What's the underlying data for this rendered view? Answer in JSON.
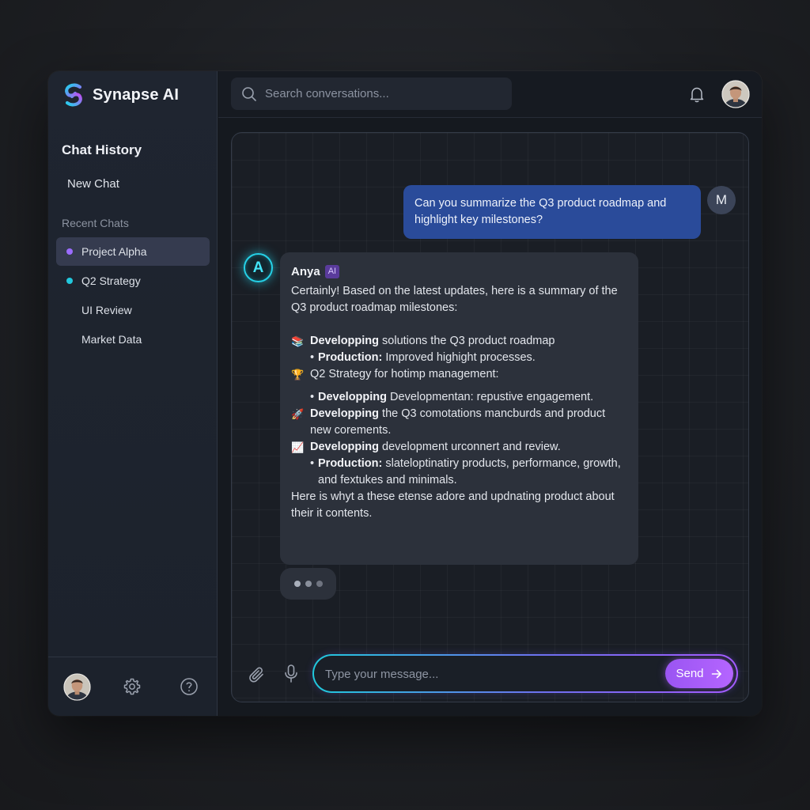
{
  "app": {
    "name": "Synapse AI"
  },
  "colors": {
    "accent": "#a45bff",
    "cyan": "#25d0e6",
    "user_bubble": "#2a4b9a"
  },
  "sidebar": {
    "title": "Chat History",
    "new_chat": "New Chat",
    "recent_label": "Recent Chats",
    "items": [
      {
        "label": "Project Alpha",
        "dot": "#9b6cff",
        "active": true
      },
      {
        "label": "Q2 Strategy",
        "dot": "#22c8dd",
        "active": false
      },
      {
        "label": "UI Review",
        "dot": "",
        "active": false
      },
      {
        "label": "Market Data",
        "dot": "",
        "active": false
      }
    ],
    "footer_icons": [
      "avatar",
      "gear-icon",
      "help-icon"
    ]
  },
  "topbar": {
    "search_placeholder": "Search conversations...",
    "icons": [
      "search-icon",
      "bell-icon",
      "avatar"
    ]
  },
  "chat": {
    "user_initial": "M",
    "user_message": "Can you summarize the Q3 product roadmap and highlight key milestones?",
    "ai_initial": "A",
    "ai_name": "Anya",
    "ai_badge": "AI",
    "ai_intro": "Certainly! Based on the latest updates, here is a summary of the Q3 product roadmap milestones:",
    "items": [
      {
        "emoji": "📚",
        "bold": "Developping",
        "text": " solutions the Q3 product roadmap"
      },
      {
        "bullet": "•",
        "bold": "Production:",
        "text": " Improved highight processes."
      },
      {
        "emoji": "🏆",
        "bold": "",
        "text": "Q2 Strategy for hotimp management:"
      },
      {
        "bullet": "•",
        "bold": "Developping",
        "text": " Developmentan: repustive engagement."
      },
      {
        "emoji": "🚀",
        "bold": "Developping",
        "text": " the Q3 comotations mancburds and product new corements."
      },
      {
        "emoji": "📈",
        "bold": "Developping",
        "text": " development urconnert and review."
      },
      {
        "bullet": "•",
        "bold": "Production:",
        "text": " slateloptinatiry products, performance, growth, and fextukes and minimals."
      }
    ],
    "ai_outro": "Here is whyt a these etense adore and updnating product about their it contents."
  },
  "composer": {
    "placeholder": "Type your message...",
    "send_label": "Send"
  }
}
